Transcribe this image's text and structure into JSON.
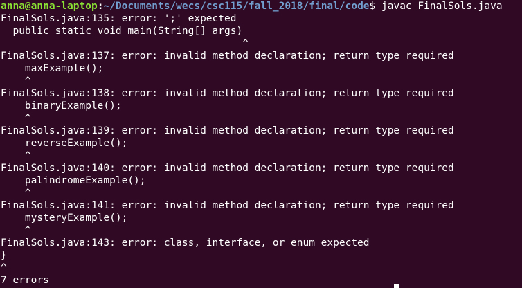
{
  "prompt": {
    "user_host": "anna@anna-laptop",
    "colon": ":",
    "path": "~/Documents/wecs/csc115/fall_2018/final/code",
    "dollar": "$ ",
    "command": "javac FinalSols.java"
  },
  "output_lines": [
    "FinalSols.java:135: error: ';' expected",
    "  public static void main(String[] args)",
    "                                        ^",
    "FinalSols.java:137: error: invalid method declaration; return type required",
    "    maxExample();",
    "    ^",
    "FinalSols.java:138: error: invalid method declaration; return type required",
    "    binaryExample();",
    "    ^",
    "FinalSols.java:139: error: invalid method declaration; return type required",
    "    reverseExample();",
    "    ^",
    "FinalSols.java:140: error: invalid method declaration; return type required",
    "    palindromeExample();",
    "    ^",
    "FinalSols.java:141: error: invalid method declaration; return type required",
    "    mysteryExample();",
    "    ^",
    "FinalSols.java:143: error: class, interface, or enum expected",
    "}",
    "^",
    "7 errors"
  ],
  "colors": {
    "background": "#300a24",
    "text": "#ffffff",
    "prompt_user": "#8ae234",
    "prompt_path": "#729fcf"
  }
}
